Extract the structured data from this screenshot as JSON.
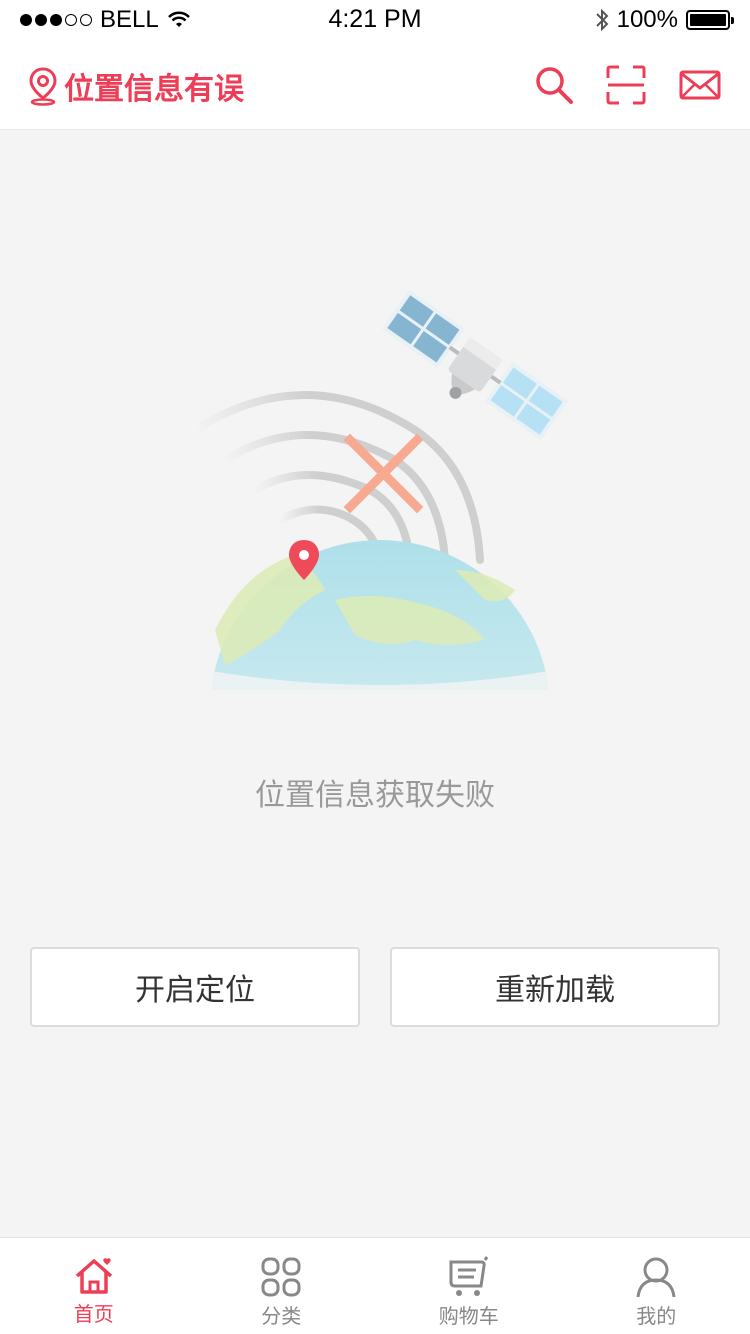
{
  "status_bar": {
    "carrier": "BELL",
    "time": "4:21 PM",
    "battery": "100%"
  },
  "header": {
    "location_text": "位置信息有误",
    "icons": [
      "location-pin-icon",
      "search-icon",
      "scan-icon",
      "mail-icon"
    ],
    "accent_color": "#ee3e57"
  },
  "main": {
    "message": "位置信息获取失败",
    "enable_location_label": "开启定位",
    "reload_label": "重新加载"
  },
  "tabbar": {
    "items": [
      {
        "label": "首页",
        "icon": "home-icon",
        "active": true
      },
      {
        "label": "分类",
        "icon": "category-icon",
        "active": false
      },
      {
        "label": "购物车",
        "icon": "cart-icon",
        "active": false
      },
      {
        "label": "我的",
        "icon": "profile-icon",
        "active": false
      }
    ]
  }
}
